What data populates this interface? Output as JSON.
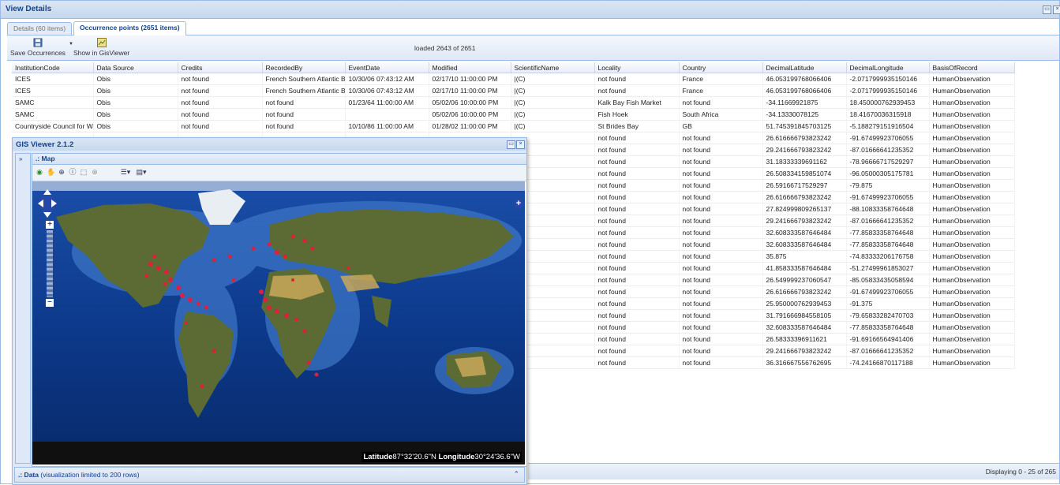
{
  "window": {
    "title": "View Details"
  },
  "tabs": [
    {
      "label": "Details (60 items)",
      "active": false
    },
    {
      "label": "Occurrence points (2651 items)",
      "active": true
    }
  ],
  "toolbar": {
    "save_label": "Save Occurrences",
    "gis_label": "Show in GisViewer",
    "loaded_text": "loaded 2643 of 2651"
  },
  "grid": {
    "columns": [
      "InstitutionCode",
      "Data Source",
      "Credits",
      "RecordedBy",
      "EventDate",
      "Modified",
      "ScientificName",
      "Locality",
      "Country",
      "DecimalLatitude",
      "DecimalLongitude",
      "BasisOfRecord"
    ],
    "rows": [
      [
        "ICES",
        "Obis",
        "not found",
        "French Southern Atlantic Bott",
        "10/30/06 07:43:12 AM",
        "02/17/10 11:00:00 PM",
        "|(C)",
        "not found",
        "France",
        "46.053199768066406",
        "-2.0717999935150146",
        "HumanObservation"
      ],
      [
        "ICES",
        "Obis",
        "not found",
        "French Southern Atlantic Bott",
        "10/30/06 07:43:12 AM",
        "02/17/10 11:00:00 PM",
        "|(C)",
        "not found",
        "France",
        "46.053199768066406",
        "-2.0717999935150146",
        "HumanObservation"
      ],
      [
        "SAMC",
        "Obis",
        "not found",
        "not found",
        "01/23/64 11:00:00 AM",
        "05/02/06 10:00:00 PM",
        "|(C)",
        "Kalk Bay Fish Market",
        "not found",
        "-34.11669921875",
        "18.450000762939453",
        "HumanObservation"
      ],
      [
        "SAMC",
        "Obis",
        "not found",
        "not found",
        "",
        "05/02/06 10:00:00 PM",
        "|(C)",
        "Fish Hoek",
        "South Africa",
        "-34.13330078125",
        "18.41670036315918",
        "HumanObservation"
      ],
      [
        "Countryside Council for Wales",
        "Obis",
        "not found",
        "not found",
        "10/10/86 11:00:00 AM",
        "01/28/02 11:00:00 PM",
        "|(C)",
        "St Brides Bay",
        "GB",
        "51.745391845703125",
        "-5.188279151916504",
        "HumanObservation"
      ],
      [
        "",
        "",
        "",
        "",
        "",
        "",
        "",
        "not found",
        "not found",
        "26.616666793823242",
        "-91.67499923706055",
        "HumanObservation"
      ],
      [
        "",
        "",
        "",
        "",
        "",
        "",
        "",
        "not found",
        "not found",
        "29.241666793823242",
        "-87.01666641235352",
        "HumanObservation"
      ],
      [
        "",
        "",
        "",
        "",
        "",
        "",
        "",
        "not found",
        "not found",
        "31.18333339691162",
        "-78.96666717529297",
        "HumanObservation"
      ],
      [
        "",
        "",
        "",
        "",
        "",
        "",
        "",
        "not found",
        "not found",
        "26.508334159851074",
        "-96.05000305175781",
        "HumanObservation"
      ],
      [
        "",
        "",
        "",
        "",
        "",
        "",
        "",
        "not found",
        "not found",
        "26.59166717529297",
        "-79.875",
        "HumanObservation"
      ],
      [
        "",
        "",
        "",
        "",
        "",
        "",
        "",
        "not found",
        "not found",
        "26.616666793823242",
        "-91.67499923706055",
        "HumanObservation"
      ],
      [
        "",
        "",
        "",
        "",
        "",
        "",
        "",
        "not found",
        "not found",
        "27.824999809265137",
        "-88.10833358764648",
        "HumanObservation"
      ],
      [
        "",
        "",
        "",
        "",
        "",
        "",
        "",
        "not found",
        "not found",
        "29.241666793823242",
        "-87.01666641235352",
        "HumanObservation"
      ],
      [
        "",
        "",
        "",
        "",
        "",
        "",
        "",
        "not found",
        "not found",
        "32.608333587646484",
        "-77.85833358764648",
        "HumanObservation"
      ],
      [
        "",
        "",
        "",
        "",
        "",
        "",
        "",
        "not found",
        "not found",
        "32.608333587646484",
        "-77.85833358764648",
        "HumanObservation"
      ],
      [
        "",
        "",
        "",
        "",
        "",
        "",
        "",
        "not found",
        "not found",
        "35.875",
        "-74.83333206176758",
        "HumanObservation"
      ],
      [
        "",
        "",
        "",
        "",
        "",
        "",
        "",
        "not found",
        "not found",
        "41.858333587646484",
        "-51.27499961853027",
        "HumanObservation"
      ],
      [
        "",
        "",
        "",
        "",
        "",
        "",
        "",
        "not found",
        "not found",
        "26.549999237060547",
        "-85.05833435058594",
        "HumanObservation"
      ],
      [
        "",
        "",
        "",
        "",
        "",
        "",
        "",
        "not found",
        "not found",
        "26.616666793823242",
        "-91.67499923706055",
        "HumanObservation"
      ],
      [
        "",
        "",
        "",
        "",
        "",
        "",
        "",
        "not found",
        "not found",
        "25.950000762939453",
        "-91.375",
        "HumanObservation"
      ],
      [
        "",
        "",
        "",
        "",
        "",
        "",
        "",
        "not found",
        "not found",
        "31.791666984558105",
        "-79.65833282470703",
        "HumanObservation"
      ],
      [
        "",
        "",
        "",
        "",
        "",
        "",
        "",
        "not found",
        "not found",
        "32.608333587646484",
        "-77.85833358764648",
        "HumanObservation"
      ],
      [
        "",
        "",
        "",
        "",
        "",
        "",
        "",
        "not found",
        "not found",
        "26.58333396911621",
        "-91.69166564941406",
        "HumanObservation"
      ],
      [
        "",
        "",
        "",
        "",
        "",
        "",
        "",
        "not found",
        "not found",
        "29.241666793823242",
        "-87.01666641235352",
        "HumanObservation"
      ],
      [
        "",
        "",
        "",
        "",
        "",
        "",
        "",
        "not found",
        "not found",
        "36.316667556762695",
        "-74.24166870117188",
        "HumanObservation"
      ]
    ]
  },
  "footer": {
    "displaying": "Displaying 0 - 25 of 265"
  },
  "gis": {
    "title": "GIS Viewer 2.1.2",
    "map_panel_title": ".: Map",
    "lat_label": "Latitude",
    "lat_value": "87°32'20.6\"N",
    "lon_label": "Longitude",
    "lon_value": "30°24'36.6\"W",
    "data_panel_title": ".: Data",
    "data_panel_note": "(visualization limited to 200 rows)"
  },
  "colors": {
    "accent": "#15428b",
    "border": "#99bbe8",
    "points": "#e0203a",
    "ocean": "#0d3a8c"
  }
}
